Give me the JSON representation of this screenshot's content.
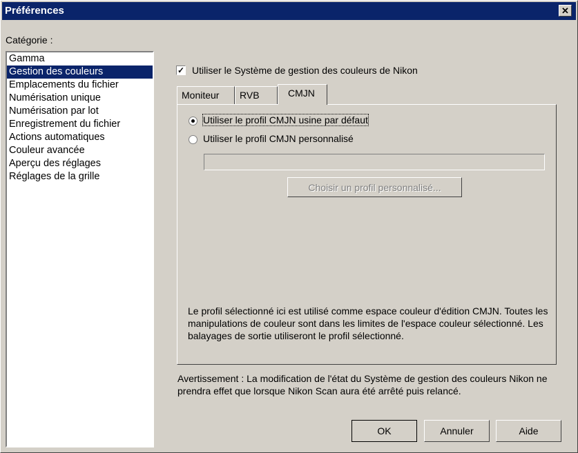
{
  "window": {
    "title": "Préférences",
    "close_icon": "close-icon"
  },
  "category": {
    "label": "Catégorie :",
    "items": [
      "Gamma",
      "Gestion des couleurs",
      "Emplacements du fichier",
      "Numérisation unique",
      "Numérisation par lot",
      "Enregistrement du fichier",
      "Actions automatiques",
      "Couleur avancée",
      "Aperçu des réglages",
      "Réglages de la grille"
    ],
    "selected_index": 1
  },
  "cms": {
    "checkbox_label": "Utiliser le Système de gestion des couleurs de Nikon",
    "checked": true
  },
  "tabs": {
    "items": [
      "Moniteur",
      "RVB",
      "CMJN"
    ],
    "active": "CMJN"
  },
  "cmyk": {
    "radio_default_label": "Utiliser le profil CMJN usine par défaut",
    "radio_custom_label": "Utiliser le profil CMJN personnalisé",
    "custom_path_value": "",
    "choose_button_label": "Choisir un profil personnalisé...",
    "description": "Le profil sélectionné ici est utilisé comme espace couleur d'édition CMJN. Toutes les manipulations de couleur sont dans les limites de l'espace couleur sélectionné. Les balayages de sortie utiliseront le profil sélectionné."
  },
  "warning": "Avertissement : La modification de l'état du Système de gestion des couleurs Nikon ne prendra effet que lorsque Nikon Scan aura été arrêté puis relancé.",
  "buttons": {
    "ok": "OK",
    "cancel": "Annuler",
    "help": "Aide"
  },
  "colors": {
    "titlebar": "#0a246a",
    "dialog_bg": "#d4d0c8",
    "selection": "#0a246a"
  }
}
